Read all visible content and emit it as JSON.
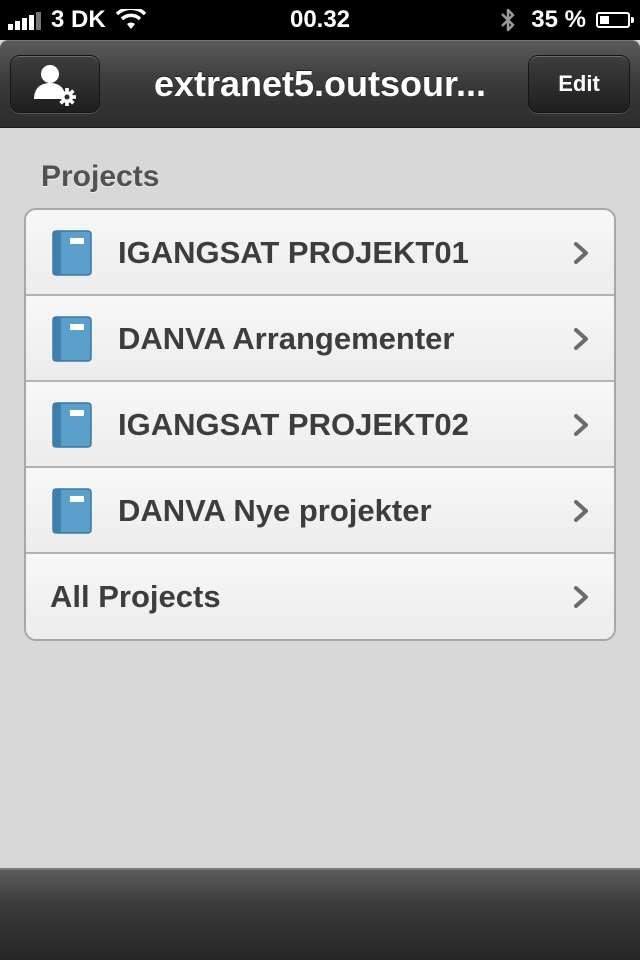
{
  "status_bar": {
    "carrier": "3 DK",
    "time": "00.32",
    "battery": "35 %",
    "battery_level": 0.35,
    "icons": [
      "signal-bars-icon",
      "wifi-icon",
      "bluetooth-icon",
      "battery-icon"
    ]
  },
  "nav": {
    "title": "extranet5.outsour...",
    "edit_label": "Edit",
    "account_icon": "user-gear-icon"
  },
  "projects": {
    "header": "Projects",
    "items": [
      {
        "label": "IGANGSAT PROJEKT01",
        "icon": "notebook-icon"
      },
      {
        "label": "DANVA Arrangementer",
        "icon": "notebook-icon"
      },
      {
        "label": "IGANGSAT PROJEKT02",
        "icon": "notebook-icon"
      },
      {
        "label": "DANVA Nye projekter",
        "icon": "notebook-icon"
      }
    ],
    "all_label": "All Projects"
  },
  "colors": {
    "background": "#d8d8d8",
    "bar_dark": "#2c2c2c",
    "notebook_blue": "#5a9fc9",
    "row_text": "#3d3d3d"
  }
}
